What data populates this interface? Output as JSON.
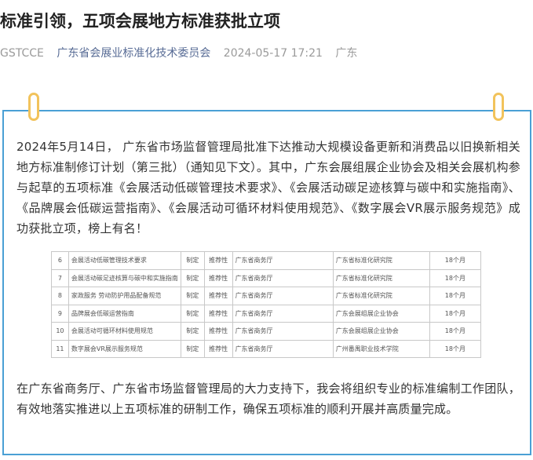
{
  "article": {
    "title": "标准引领，五项会展地方标准获批立项",
    "meta": {
      "source": "GSTCCE",
      "account": "广东省会展业标准化技术委员会",
      "datetime": "2024-05-17 17:21",
      "location": "广东"
    }
  },
  "content": {
    "paragraph1": "2024年5月14日， 广东省市场监督管理局批准下达推动大规模设备更新和消费品以旧换新相关地方标准制修订计划（第三批）（通知见下文）。其中，广东会展组展企业协会及相关会展机构参与起草的五项标准《会展活动低碳管理技术要求》、《会展活动碳足迹核算与碳中和实施指南》、《品牌展会低碳运营指南》、《会展活动可循环材料使用规范》、《数字展会VR展示服务规范》成功获批立项，榜上有名！",
    "paragraph2": "在广东省商务厅、广东省市场监督管理局的大力支持下，我会将组织专业的标准编制工作团队，有效地落实推进以上五项标准的研制工作，确保五项标准的顺利开展并高质量完成。",
    "table_rows": [
      {
        "no": "6",
        "name": "会展活动低碳管理技术要求",
        "type": "制定",
        "nature": "推荐性",
        "dept": "广东省商务厅",
        "unit": "广东省标准化研究院",
        "cycle": "18个月"
      },
      {
        "no": "7",
        "name": "会展活动碳足迹核算与碳中和实施指南",
        "type": "制定",
        "nature": "推荐性",
        "dept": "广东省商务厅",
        "unit": "广东省标准化研究院",
        "cycle": "18个月"
      },
      {
        "no": "8",
        "name": "家政服务 劳动防护用品配备规范",
        "type": "制定",
        "nature": "推荐性",
        "dept": "广东省商务厅",
        "unit": "广东省标准化研究院",
        "cycle": "18个月"
      },
      {
        "no": "9",
        "name": "品牌展会低碳运营指南",
        "type": "制定",
        "nature": "推荐性",
        "dept": "广东省商务厅",
        "unit": "广东会展组展企业协会",
        "cycle": "18个月"
      },
      {
        "no": "10",
        "name": "会展活动可循环材料使用规范",
        "type": "制定",
        "nature": "推荐性",
        "dept": "广东省商务厅",
        "unit": "广东会展组展企业协会",
        "cycle": "18个月"
      },
      {
        "no": "11",
        "name": "数字展会VR展示服务规范",
        "type": "制定",
        "nature": "推荐性",
        "dept": "广东省商务厅",
        "unit": "广州番禺职业技术学院",
        "cycle": "18个月"
      }
    ]
  },
  "colors": {
    "border": "#4aa0d5",
    "clip": "#f2c35c",
    "account_link": "#576b95"
  }
}
